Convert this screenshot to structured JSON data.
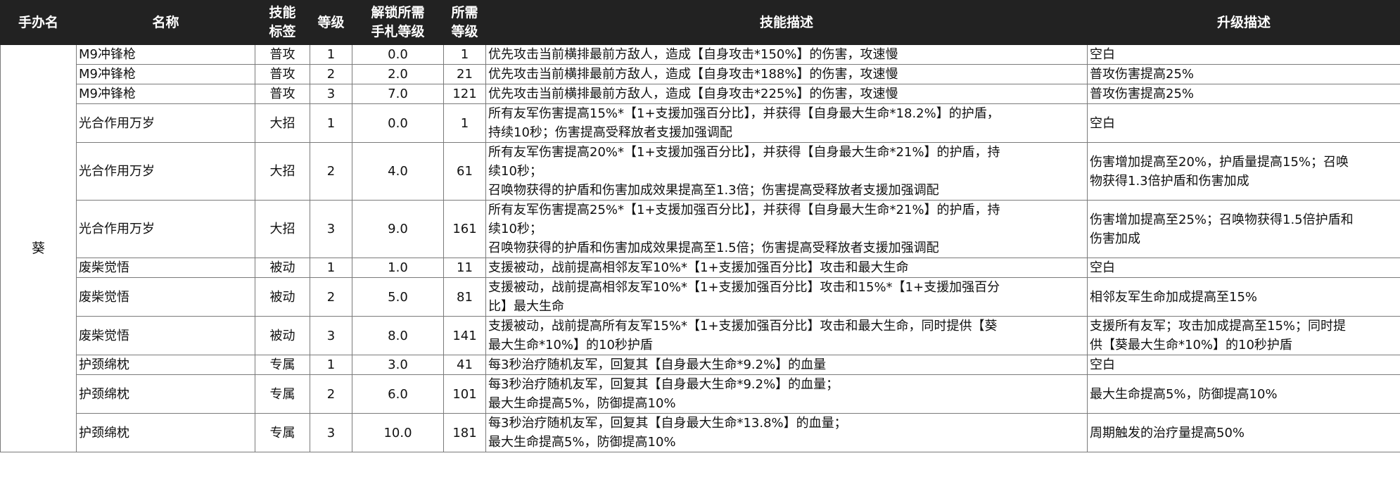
{
  "columns": {
    "owner": "手办名",
    "name": "名称",
    "tag": [
      "技能",
      "标签"
    ],
    "level": "等级",
    "unlock": [
      "解锁所需",
      "手札等级"
    ],
    "req": [
      "所需",
      "等级"
    ],
    "desc": "技能描述",
    "upgrade": "升级描述"
  },
  "owner": "葵",
  "rows": [
    {
      "name": "M9冲锋枪",
      "tag": "普攻",
      "level": "1",
      "unlock": "0.0",
      "req": "1",
      "desc": [
        "优先攻击当前横排最前方敌人，造成【自身攻击*150%】的伤害，攻速慢"
      ],
      "upgrade": [
        "空白"
      ]
    },
    {
      "name": "M9冲锋枪",
      "tag": "普攻",
      "level": "2",
      "unlock": "2.0",
      "req": "21",
      "desc": [
        "优先攻击当前横排最前方敌人，造成【自身攻击*188%】的伤害，攻速慢"
      ],
      "upgrade": [
        "普攻伤害提高25%"
      ]
    },
    {
      "name": "M9冲锋枪",
      "tag": "普攻",
      "level": "3",
      "unlock": "7.0",
      "req": "121",
      "desc": [
        "优先攻击当前横排最前方敌人，造成【自身攻击*225%】的伤害，攻速慢"
      ],
      "upgrade": [
        "普攻伤害提高25%"
      ]
    },
    {
      "name": "光合作用万岁",
      "tag": "大招",
      "level": "1",
      "unlock": "0.0",
      "req": "1",
      "desc": [
        "所有友军伤害提高15%*【1+支援加强百分比】，并获得【自身最大生命*18.2%】的护盾，",
        "持续10秒；伤害提高受释放者支援加强调配"
      ],
      "upgrade": [
        "空白"
      ]
    },
    {
      "name": "光合作用万岁",
      "tag": "大招",
      "level": "2",
      "unlock": "4.0",
      "req": "61",
      "desc": [
        "所有友军伤害提高20%*【1+支援加强百分比】，并获得【自身最大生命*21%】的护盾，持",
        "续10秒；",
        "召唤物获得的护盾和伤害加成效果提高至1.3倍；伤害提高受释放者支援加强调配"
      ],
      "upgrade": [
        "伤害增加提高至20%，护盾量提高15%；召唤",
        "物获得1.3倍护盾和伤害加成"
      ]
    },
    {
      "name": "光合作用万岁",
      "tag": "大招",
      "level": "3",
      "unlock": "9.0",
      "req": "161",
      "desc": [
        "所有友军伤害提高25%*【1+支援加强百分比】，并获得【自身最大生命*21%】的护盾，持",
        "续10秒；",
        "召唤物获得的护盾和伤害加成效果提高至1.5倍；伤害提高受释放者支援加强调配"
      ],
      "upgrade": [
        "伤害增加提高至25%；召唤物获得1.5倍护盾和",
        "伤害加成"
      ]
    },
    {
      "name": "废柴觉悟",
      "tag": "被动",
      "level": "1",
      "unlock": "1.0",
      "req": "11",
      "desc": [
        "支援被动，战前提高相邻友军10%*【1+支援加强百分比】攻击和最大生命"
      ],
      "upgrade": [
        "空白"
      ]
    },
    {
      "name": "废柴觉悟",
      "tag": "被动",
      "level": "2",
      "unlock": "5.0",
      "req": "81",
      "desc": [
        "支援被动，战前提高相邻友军10%*【1+支援加强百分比】攻击和15%*【1+支援加强百分",
        "比】最大生命"
      ],
      "upgrade": [
        "相邻友军生命加成提高至15%"
      ]
    },
    {
      "name": "废柴觉悟",
      "tag": "被动",
      "level": "3",
      "unlock": "8.0",
      "req": "141",
      "desc": [
        "支援被动，战前提高所有友军15%*【1+支援加强百分比】攻击和最大生命，同时提供【葵",
        "最大生命*10%】的10秒护盾"
      ],
      "upgrade": [
        "支援所有友军；攻击加成提高至15%；同时提",
        "供【葵最大生命*10%】的10秒护盾"
      ]
    },
    {
      "name": "护颈绵枕",
      "tag": "专属",
      "level": "1",
      "unlock": "3.0",
      "req": "41",
      "desc": [
        "每3秒治疗随机友军，回复其【自身最大生命*9.2%】的血量"
      ],
      "upgrade": [
        "空白"
      ]
    },
    {
      "name": "护颈绵枕",
      "tag": "专属",
      "level": "2",
      "unlock": "6.0",
      "req": "101",
      "desc": [
        "每3秒治疗随机友军，回复其【自身最大生命*9.2%】的血量；",
        "最大生命提高5%，防御提高10%"
      ],
      "upgrade": [
        "最大生命提高5%，防御提高10%"
      ]
    },
    {
      "name": "护颈绵枕",
      "tag": "专属",
      "level": "3",
      "unlock": "10.0",
      "req": "181",
      "desc": [
        "每3秒治疗随机友军，回复其【自身最大生命*13.8%】的血量；",
        "最大生命提高5%，防御提高10%"
      ],
      "upgrade": [
        "周期触发的治疗量提高50%"
      ]
    }
  ]
}
